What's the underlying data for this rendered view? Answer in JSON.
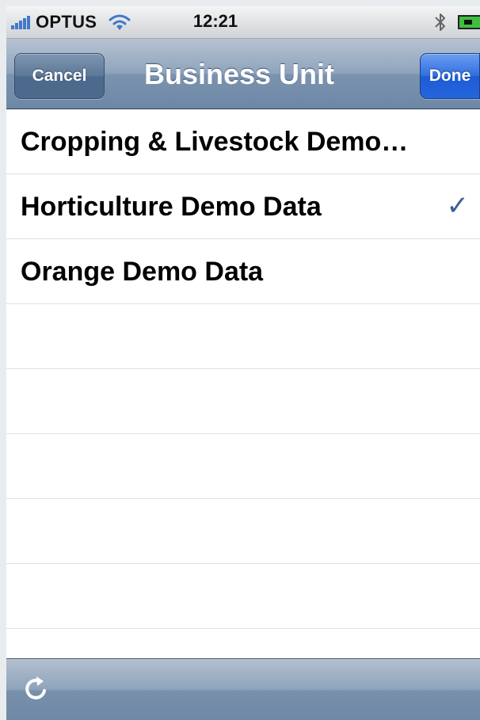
{
  "status_bar": {
    "carrier": "OPTUS",
    "time": "12:21"
  },
  "nav": {
    "title": "Business Unit",
    "cancel_label": "Cancel",
    "done_label": "Done"
  },
  "list": {
    "items": [
      {
        "label": "Cropping & Livestock Demo…",
        "checked": false
      },
      {
        "label": "Horticulture Demo Data",
        "checked": true
      },
      {
        "label": "Orange Demo Data",
        "checked": false
      }
    ],
    "check_glyph": "✓"
  },
  "colors": {
    "nav_bar": "#8ea3bb",
    "done_button": "#2f6ee0",
    "checkmark": "#3b5f94"
  },
  "icons": {
    "toolbar": "refresh-icon",
    "status": [
      "signal-icon",
      "wifi-icon",
      "bluetooth-icon",
      "battery-icon"
    ]
  }
}
